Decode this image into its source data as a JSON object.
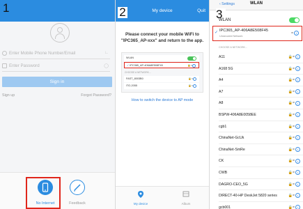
{
  "panel1": {
    "step": "1",
    "phone_placeholder": "Enter Mobile Phone Number/Email",
    "password_placeholder": "Enter Password",
    "signin_label": "Sign in",
    "signup_label": "Sign up",
    "forgot_label": "Forgot Password?",
    "tabs": [
      {
        "label": "No Internet"
      },
      {
        "label": "Feedback"
      }
    ]
  },
  "panel2": {
    "step": "2",
    "title": "My device",
    "quit_label": "Quit",
    "instruction": "Please connect your mobile WiFi to \"IPC365_AP-xxx\" and return to the app.",
    "mini": {
      "wlan": "WLAN",
      "connected": "IPC365_AP-406A8E508F45",
      "choose": "CHOOSE A NETWORK...",
      "networks": [
        "FAST_8003B0",
        "ITO-2055"
      ]
    },
    "how_link": "How to switch the device to AP mode",
    "tabs": [
      {
        "label": "My device"
      },
      {
        "label": "Album"
      }
    ]
  },
  "panel3": {
    "step": "3",
    "back_label": "Settings",
    "nav_title": "WLAN",
    "wlan_label": "WLAN",
    "connected": {
      "name": "IPC365_AP-406A8E508F45",
      "sub": "Unsecured Network"
    },
    "choose_label": "CHOOSE A NETWORK...",
    "networks": [
      {
        "name": "A11"
      },
      {
        "name": "A168 5G"
      },
      {
        "name": "A4"
      },
      {
        "name": "A7"
      },
      {
        "name": "A8"
      },
      {
        "name": "BSPW-406A8E0058EE"
      },
      {
        "name": "cgb1"
      },
      {
        "name": "ChinaNet-GcUk"
      },
      {
        "name": "ChinaNet-SmRe"
      },
      {
        "name": "CK"
      },
      {
        "name": "CWB"
      },
      {
        "name": "DAGRO-CEO_5G"
      },
      {
        "name": "DIRECT-40-HP DeskJet 5820 series"
      },
      {
        "name": "gcb001"
      }
    ]
  },
  "colors": {
    "header_blue": "#2b8ce0",
    "highlight_red": "#e0261b",
    "toggle_green": "#4cd964",
    "link_blue": "#2b7ad6"
  }
}
